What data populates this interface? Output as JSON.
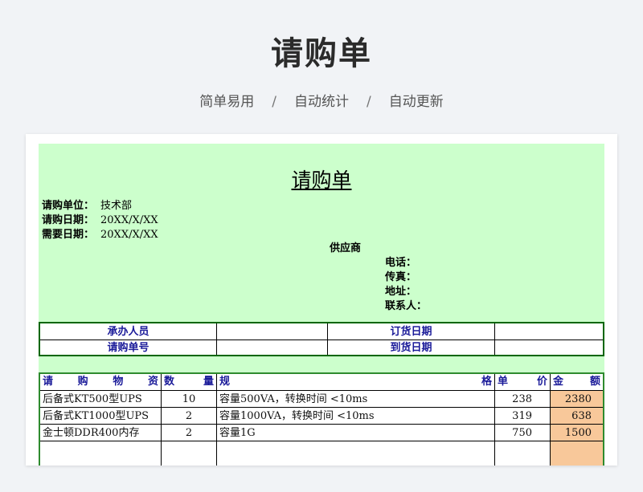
{
  "header": {
    "title": "请购单",
    "tags": [
      "简单易用",
      "自动统计",
      "自动更新"
    ],
    "separator": "/"
  },
  "form": {
    "title": "请购单",
    "meta": [
      {
        "label": "请购单位：",
        "value": "技术部"
      },
      {
        "label": "请购日期：",
        "value": "20XX/X/XX"
      },
      {
        "label": "需要日期：",
        "value": "20XX/X/XX"
      }
    ],
    "supplier_label": "供应商",
    "contact": [
      "电话：",
      "传真：",
      "地址：",
      "联系人："
    ],
    "info": {
      "handler_label": "承办人员",
      "handler_value": "",
      "order_date_label": "订货日期",
      "order_date_value": "",
      "request_no_label": "请购单号",
      "request_no_value": "",
      "arrival_date_label": "到货日期",
      "arrival_date_value": ""
    },
    "columns": {
      "material": [
        "请",
        "购",
        "物",
        "资"
      ],
      "qty": [
        "数",
        "量"
      ],
      "spec": [
        "规",
        "格"
      ],
      "price": [
        "单",
        "价"
      ],
      "amount": [
        "金",
        "额"
      ]
    },
    "rows": [
      {
        "material": "后备式KT500型UPS",
        "qty": "10",
        "spec": "容量500VA，转换时间 <10ms",
        "price": "238",
        "amount": "2380"
      },
      {
        "material": "后备式KT1000型UPS",
        "qty": "2",
        "spec": "容量1000VA，转换时间 <10ms",
        "price": "319",
        "amount": "638"
      },
      {
        "material": "金士顿DDR400内存",
        "qty": "2",
        "spec": "容量1G",
        "price": "750",
        "amount": "1500"
      }
    ]
  },
  "colors": {
    "sheet_bg": "#ccffcc",
    "amount_bg": "#f8c89a",
    "header_text": "#1a1a99",
    "border": "#006600"
  }
}
